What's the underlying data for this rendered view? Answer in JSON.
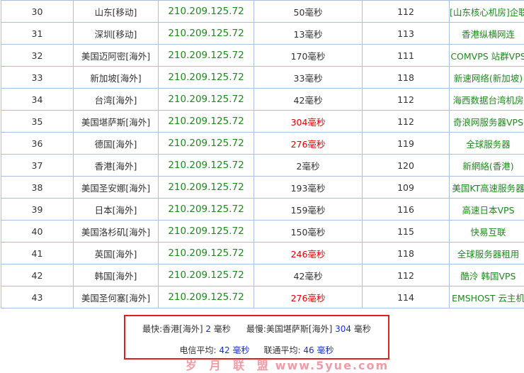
{
  "rows": [
    {
      "no": "30",
      "location": "山东[移动]",
      "ip": "210.209.125.72",
      "time": "50毫秒",
      "slow": false,
      "ttl": "112",
      "provider": "[山东核心机房]企联"
    },
    {
      "no": "31",
      "location": "深圳[移动]",
      "ip": "210.209.125.72",
      "time": "13毫秒",
      "slow": false,
      "ttl": "113",
      "provider": "香港纵横网连"
    },
    {
      "no": "32",
      "location": "美国迈阿密[海外]",
      "ip": "210.209.125.72",
      "time": "170毫秒",
      "slow": false,
      "ttl": "111",
      "provider": "COMVPS 站群VPS"
    },
    {
      "no": "33",
      "location": "新加坡[海外]",
      "ip": "210.209.125.72",
      "time": "33毫秒",
      "slow": false,
      "ttl": "118",
      "provider": "新速网络(新加坡)"
    },
    {
      "no": "34",
      "location": "台湾[海外]",
      "ip": "210.209.125.72",
      "time": "42毫秒",
      "slow": false,
      "ttl": "112",
      "provider": "海西数据台湾机房"
    },
    {
      "no": "35",
      "location": "美国堪萨斯[海外]",
      "ip": "210.209.125.72",
      "time": "304毫秒",
      "slow": true,
      "ttl": "112",
      "provider": "奇浪网服务器VPS"
    },
    {
      "no": "36",
      "location": "德国[海外]",
      "ip": "210.209.125.72",
      "time": "276毫秒",
      "slow": true,
      "ttl": "119",
      "provider": "全球服务器"
    },
    {
      "no": "37",
      "location": "香港[海外]",
      "ip": "210.209.125.72",
      "time": "2毫秒",
      "slow": false,
      "ttl": "120",
      "provider": "新網絡(香港)"
    },
    {
      "no": "38",
      "location": "美国圣安娜[海外]",
      "ip": "210.209.125.72",
      "time": "193毫秒",
      "slow": false,
      "ttl": "109",
      "provider": "美国KT高速服务器"
    },
    {
      "no": "39",
      "location": "日本[海外]",
      "ip": "210.209.125.72",
      "time": "159毫秒",
      "slow": false,
      "ttl": "116",
      "provider": "高速日本VPS"
    },
    {
      "no": "40",
      "location": "美国洛杉矶[海外]",
      "ip": "210.209.125.72",
      "time": "150毫秒",
      "slow": false,
      "ttl": "115",
      "provider": "快易互联"
    },
    {
      "no": "41",
      "location": "英国[海外]",
      "ip": "210.209.125.72",
      "time": "246毫秒",
      "slow": true,
      "ttl": "118",
      "provider": "全球服务器租用"
    },
    {
      "no": "42",
      "location": "韩国[海外]",
      "ip": "210.209.125.72",
      "time": "42毫秒",
      "slow": false,
      "ttl": "112",
      "provider": "酷泠 韩国VPS"
    },
    {
      "no": "43",
      "location": "美国圣何塞[海外]",
      "ip": "210.209.125.72",
      "time": "276毫秒",
      "slow": true,
      "ttl": "114",
      "provider": "EMSHOST 云主机"
    }
  ],
  "colors": {
    "ip_green": "#1e8a1e",
    "slow_red": "#e00000",
    "number_blue": "#1a2fd0",
    "summary_border": "#e0201a",
    "table_border": "#a9c1df"
  },
  "summary": {
    "fastest_label": "最快:",
    "fastest_location": "香港[海外]",
    "fastest_value": "2",
    "fastest_unit": "毫秒",
    "slowest_label": "最慢:",
    "slowest_location": "美国堪萨斯[海外]",
    "slowest_value": "304",
    "slowest_unit": "毫秒",
    "telecom_label": "电信平均:",
    "telecom_value": "42",
    "telecom_unit": "毫秒",
    "unicom_label": "联通平均:",
    "unicom_value": "46",
    "unicom_unit": "毫秒"
  },
  "watermark": {
    "brand": "岁 月 联 盟",
    "url": "www.5yue.com"
  }
}
